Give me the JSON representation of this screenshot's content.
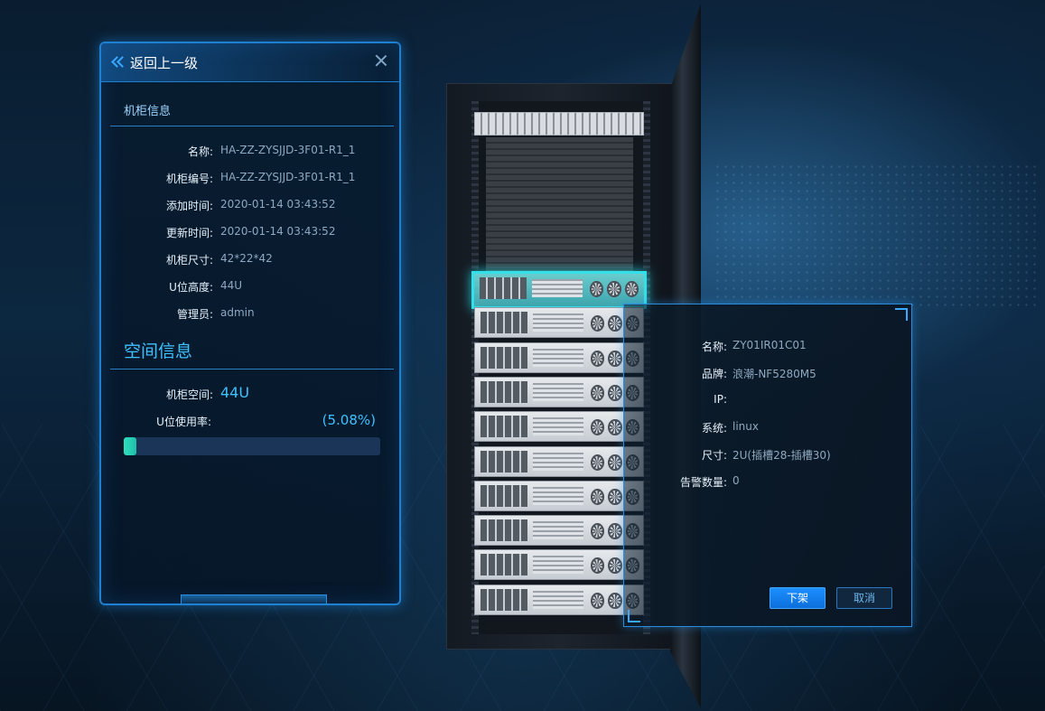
{
  "back_button": {
    "label": "返回上一级"
  },
  "cabinet_info": {
    "title": "机柜信息",
    "rows": [
      {
        "label": "名称:",
        "value": "HA-ZZ-ZYSJJD-3F01-R1_1"
      },
      {
        "label": "机柜编号:",
        "value": "HA-ZZ-ZYSJJD-3F01-R1_1"
      },
      {
        "label": "添加时间:",
        "value": "2020-01-14 03:43:52"
      },
      {
        "label": "更新时间:",
        "value": "2020-01-14 03:43:52"
      },
      {
        "label": "机柜尺寸:",
        "value": "42*22*42"
      },
      {
        "label": "U位高度:",
        "value": "44U"
      },
      {
        "label": "管理员:",
        "value": "admin"
      }
    ]
  },
  "space_info": {
    "title": "空间信息",
    "space_label": "机柜空间:",
    "space_value": "44U",
    "usage_label": "U位使用率:",
    "usage_value": "(5.08%)",
    "usage_fraction": 0.0508
  },
  "device_detail": {
    "rows": [
      {
        "label": "名称:",
        "value": "ZY01IR01C01"
      },
      {
        "label": "品牌:",
        "value": "浪潮-NF5280M5"
      },
      {
        "label": "IP:",
        "value": ""
      },
      {
        "label": "系统:",
        "value": "linux"
      },
      {
        "label": "尺寸:",
        "value": "2U(插槽28-插槽30)"
      },
      {
        "label": "告警数量:",
        "value": "0"
      }
    ],
    "confirm_label": "下架",
    "cancel_label": "取消"
  },
  "rack": {
    "server_count": 10,
    "selected_index": 0
  },
  "colors": {
    "accent": "#3fc1ff",
    "highlight": "#33e0ea",
    "primary_button": "#1d8fff",
    "progress": "#2fe0c0"
  },
  "icons": {
    "back": "double-chevron-left-icon",
    "close": "close-icon"
  }
}
